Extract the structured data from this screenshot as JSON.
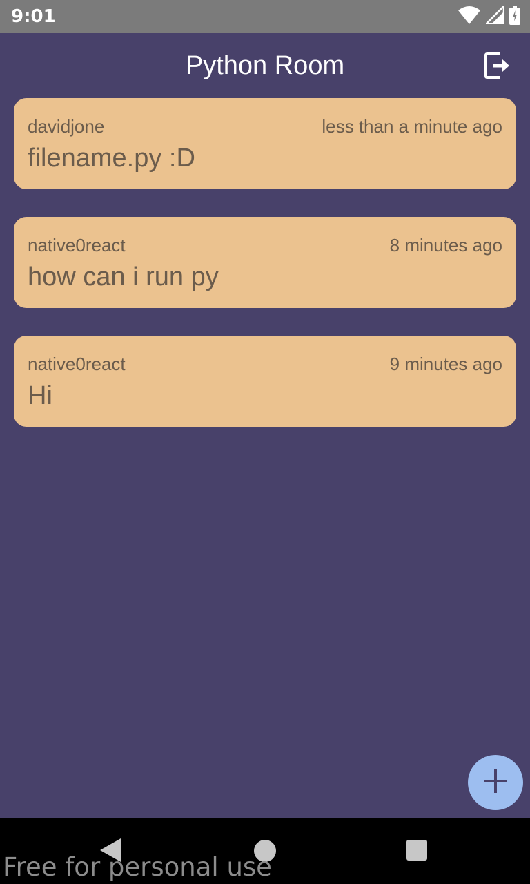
{
  "status_bar": {
    "time": "9:01",
    "icons": [
      "wifi-icon",
      "signal-icon",
      "battery-icon"
    ]
  },
  "header": {
    "title": "Python Room",
    "logout_icon": "logout-icon"
  },
  "messages": [
    {
      "user": "davidjone",
      "time": "less than a minute ago",
      "text": "filename.py :D"
    },
    {
      "user": "native0react",
      "time": "8 minutes ago",
      "text": "how can i run py"
    },
    {
      "user": "native0react",
      "time": "9 minutes ago",
      "text": "Hi"
    }
  ],
  "fab": {
    "icon": "plus-icon"
  },
  "nav_bar": {
    "icons": [
      "back-icon",
      "home-icon",
      "recents-icon"
    ]
  },
  "watermark": "Free for personal use",
  "colors": {
    "background": "#48416a",
    "card": "#ebc28f",
    "card_text": "#6b5c4c",
    "fab": "#9dbef0",
    "status_bar": "#7b7b7b"
  }
}
